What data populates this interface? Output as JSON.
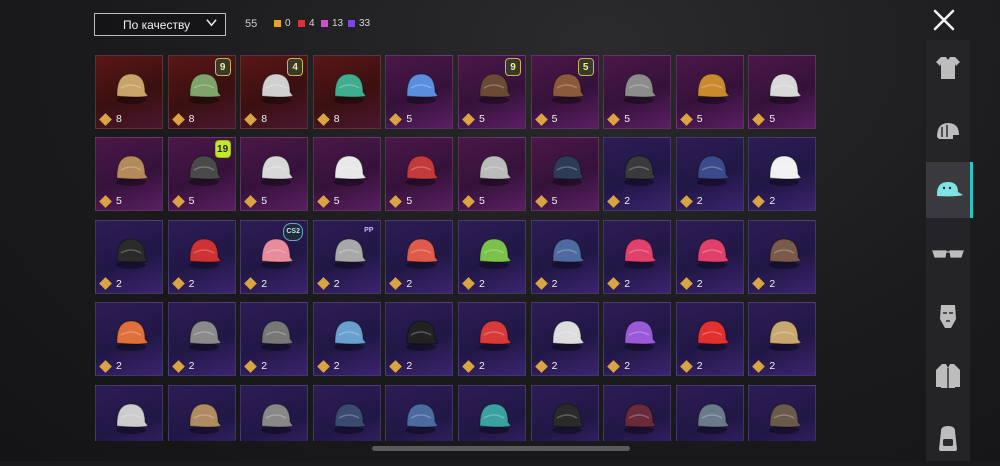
{
  "header": {
    "sort_label": "По качеству",
    "total_count": "55",
    "quality_counts": [
      {
        "color": "#e0a528",
        "count": "0"
      },
      {
        "color": "#d8323a",
        "count": "4"
      },
      {
        "color": "#d44bd0",
        "count": "13"
      },
      {
        "color": "#7a48e0",
        "count": "33"
      }
    ]
  },
  "sidebar": {
    "items": [
      {
        "icon": "outfit-icon",
        "active": false
      },
      {
        "icon": "helmet-icon",
        "active": false
      },
      {
        "icon": "cap-icon",
        "active": true
      },
      {
        "icon": "glasses-icon",
        "active": false
      },
      {
        "icon": "mask-icon",
        "active": false
      },
      {
        "icon": "jacket-icon",
        "active": false
      },
      {
        "icon": "backpack-icon",
        "active": false
      }
    ]
  },
  "grid": {
    "items": [
      {
        "rarity": "red",
        "count": "8",
        "icon": "blonde-hair-icon",
        "badge": ""
      },
      {
        "rarity": "red",
        "count": "8",
        "icon": "zombie-head-icon",
        "badge": "9"
      },
      {
        "rarity": "red",
        "count": "8",
        "icon": "eyeball-hat-icon",
        "badge": "4"
      },
      {
        "rarity": "red",
        "count": "8",
        "icon": "dragon-helmet-icon",
        "badge": ""
      },
      {
        "rarity": "mag",
        "count": "5",
        "icon": "blue-bird-hat-icon",
        "badge": ""
      },
      {
        "rarity": "mag",
        "count": "5",
        "icon": "dark-hair-icon",
        "badge": "9"
      },
      {
        "rarity": "mag",
        "count": "5",
        "icon": "brown-hair-icon",
        "badge": "5"
      },
      {
        "rarity": "mag",
        "count": "5",
        "icon": "spiked-helmet-icon",
        "badge": ""
      },
      {
        "rarity": "mag",
        "count": "5",
        "icon": "feather-headdress-icon",
        "badge": ""
      },
      {
        "rarity": "mag",
        "count": "5",
        "icon": "rooster-head-icon",
        "badge": ""
      },
      {
        "rarity": "mag",
        "count": "5",
        "icon": "steampunk-helmet-icon",
        "badge": ""
      },
      {
        "rarity": "mag",
        "count": "5",
        "icon": "robot-head-icon",
        "badge": "19"
      },
      {
        "rarity": "mag",
        "count": "5",
        "icon": "dreadlocks-icon",
        "badge": ""
      },
      {
        "rarity": "mag",
        "count": "5",
        "icon": "zebra-head-icon",
        "badge": ""
      },
      {
        "rarity": "mag",
        "count": "5",
        "icon": "red-monster-icon",
        "badge": ""
      },
      {
        "rarity": "mag",
        "count": "5",
        "icon": "white-hair-skull-icon",
        "badge": ""
      },
      {
        "rarity": "mag",
        "count": "5",
        "icon": "tactical-helmet-icon",
        "badge": ""
      },
      {
        "rarity": "pur",
        "count": "2",
        "icon": "gas-mask-helmet-icon",
        "badge": ""
      },
      {
        "rarity": "pur",
        "count": "2",
        "icon": "cowl-helmet-icon",
        "badge": ""
      },
      {
        "rarity": "pur",
        "count": "2",
        "icon": "sun-hat-icon",
        "badge": ""
      },
      {
        "rarity": "pur",
        "count": "2",
        "icon": "black-cap-icon",
        "badge": ""
      },
      {
        "rarity": "pur",
        "count": "2",
        "icon": "bucket-hat-hair-icon",
        "badge": ""
      },
      {
        "rarity": "pur",
        "count": "2",
        "icon": "pink-beanie-icon",
        "badge": "CS2"
      },
      {
        "rarity": "pur",
        "count": "2",
        "icon": "silver-wig-icon",
        "badge": "PP"
      },
      {
        "rarity": "pur",
        "count": "2",
        "icon": "motorcycle-helmet-icon",
        "badge": ""
      },
      {
        "rarity": "pur",
        "count": "2",
        "icon": "green-cap-icon",
        "badge": ""
      },
      {
        "rarity": "pur",
        "count": "2",
        "icon": "navy-cap-icon",
        "badge": ""
      },
      {
        "rarity": "pur",
        "count": "2",
        "icon": "pink-cap-icon",
        "badge": ""
      },
      {
        "rarity": "pur",
        "count": "2",
        "icon": "pink-beret-icon",
        "badge": ""
      },
      {
        "rarity": "pur",
        "count": "2",
        "icon": "aviator-cap-icon",
        "badge": ""
      },
      {
        "rarity": "pur",
        "count": "2",
        "icon": "football-helmet-icon",
        "badge": ""
      },
      {
        "rarity": "pur",
        "count": "2",
        "icon": "police-helmet-icon",
        "badge": ""
      },
      {
        "rarity": "pur",
        "count": "2",
        "icon": "wrestler-mask-icon",
        "badge": ""
      },
      {
        "rarity": "pur",
        "count": "2",
        "icon": "shark-hat-icon",
        "badge": ""
      },
      {
        "rarity": "pur",
        "count": "2",
        "icon": "black-fedora-icon",
        "badge": ""
      },
      {
        "rarity": "pur",
        "count": "2",
        "icon": "red-fedora-icon",
        "badge": ""
      },
      {
        "rarity": "pur",
        "count": "2",
        "icon": "shark-mask-icon",
        "badge": ""
      },
      {
        "rarity": "pur",
        "count": "2",
        "icon": "flower-crown-icon",
        "badge": ""
      },
      {
        "rarity": "pur",
        "count": "2",
        "icon": "red-bucket-hat-icon",
        "badge": ""
      },
      {
        "rarity": "pur",
        "count": "2",
        "icon": "knit-beanie-icon",
        "badge": ""
      },
      {
        "rarity": "pur",
        "count": "",
        "icon": "headlamp-icon",
        "badge": ""
      },
      {
        "rarity": "pur",
        "count": "",
        "icon": "paper-bag-icon",
        "badge": ""
      },
      {
        "rarity": "pur",
        "count": "",
        "icon": "visor-icon",
        "badge": ""
      },
      {
        "rarity": "pur",
        "count": "",
        "icon": "officer-cap-icon",
        "badge": ""
      },
      {
        "rarity": "pur",
        "count": "",
        "icon": "sailor-cap-icon",
        "badge": ""
      },
      {
        "rarity": "pur",
        "count": "",
        "icon": "teal-cap-icon",
        "badge": ""
      },
      {
        "rarity": "pur",
        "count": "",
        "icon": "gold-logo-cap-icon",
        "badge": ""
      },
      {
        "rarity": "pur",
        "count": "",
        "icon": "maroon-fedora-icon",
        "badge": ""
      },
      {
        "rarity": "pur",
        "count": "",
        "icon": "checkered-helmet-icon",
        "badge": ""
      },
      {
        "rarity": "pur",
        "count": "",
        "icon": "pilot-goggles-helmet-icon",
        "badge": ""
      }
    ]
  }
}
